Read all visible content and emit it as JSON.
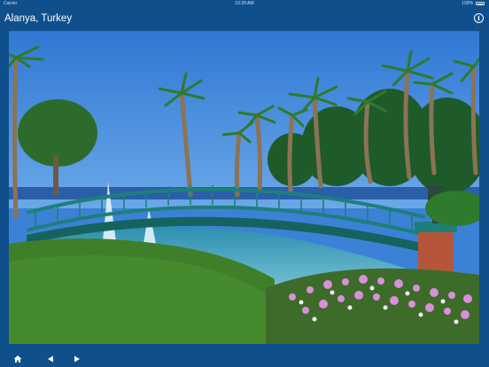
{
  "status_bar": {
    "carrier": "Carrier",
    "time": "10:28 AM",
    "battery": "100%"
  },
  "nav": {
    "title": "Alanya, Turkey",
    "info_icon": "info-circle-icon",
    "info_glyph": "i"
  },
  "photo": {
    "description_icon": "photo"
  },
  "toolbar": {
    "home_icon": "home-icon",
    "previous_icon": "arrow-left-icon",
    "next_icon": "arrow-right-icon"
  },
  "colors": {
    "bar": "#0f4f8c",
    "sky": "#3b82d6",
    "bridge": "#1e7f7a",
    "grass": "#3f7f2a"
  }
}
